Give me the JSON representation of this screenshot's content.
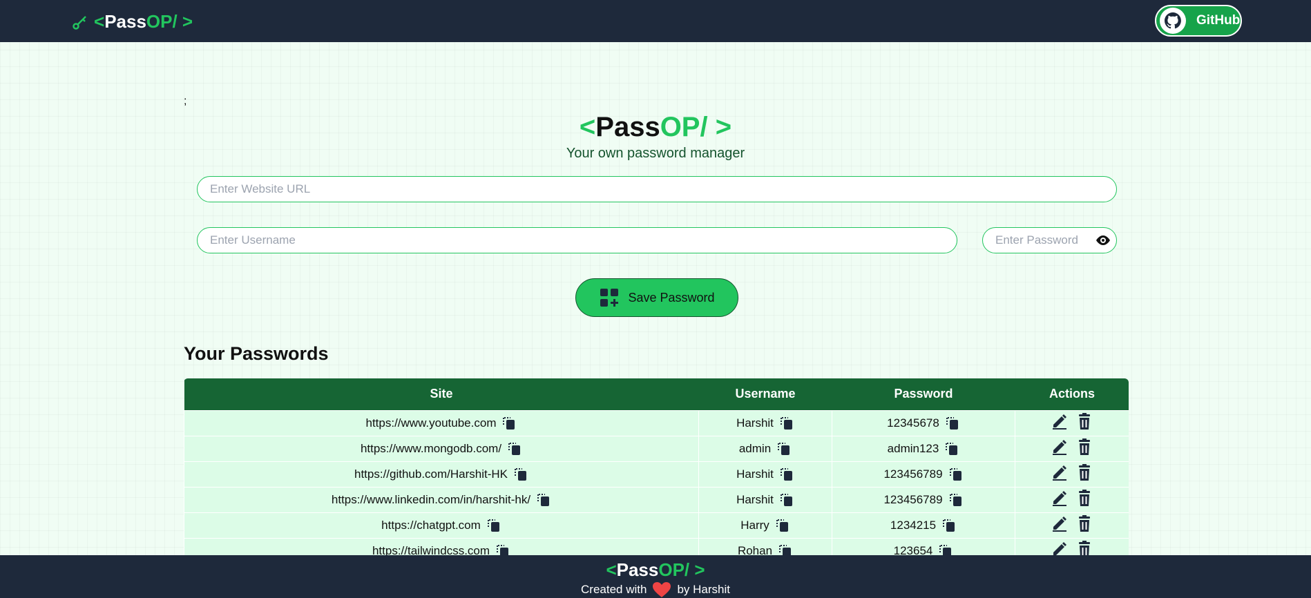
{
  "navbar": {
    "brand_open": "<",
    "brand_pass": "Pass",
    "brand_op": "OP/ >",
    "github_label": "GitHub"
  },
  "stray_text": ";",
  "hero": {
    "brand_open": "<",
    "brand_pass": "Pass",
    "brand_op": "OP/ >",
    "subtitle": "Your own password manager"
  },
  "form": {
    "url_placeholder": "Enter Website URL",
    "username_placeholder": "Enter Username",
    "password_placeholder": "Enter Password",
    "save_label": "Save Password"
  },
  "section": {
    "heading": "Your Passwords"
  },
  "table": {
    "headers": {
      "site": "Site",
      "username": "Username",
      "password": "Password",
      "actions": "Actions"
    },
    "rows": [
      {
        "site": "https://www.youtube.com",
        "username": "Harshit",
        "password": "12345678"
      },
      {
        "site": "https://www.mongodb.com/",
        "username": "admin",
        "password": "admin123"
      },
      {
        "site": "https://github.com/Harshit-HK",
        "username": "Harshit",
        "password": "123456789"
      },
      {
        "site": "https://www.linkedin.com/in/harshit-hk/",
        "username": "Harshit",
        "password": "123456789"
      },
      {
        "site": "https://chatgpt.com",
        "username": "Harry",
        "password": "1234215"
      },
      {
        "site": "https://tailwindcss.com",
        "username": "Rohan",
        "password": "123654"
      }
    ]
  },
  "footer": {
    "brand_open": "<",
    "brand_pass": "Pass",
    "brand_op": "OP/ >",
    "created_with": "Created with",
    "by": "by Harshit"
  },
  "colors": {
    "nav_bg": "#1e293b",
    "accent_green": "#22c55e",
    "table_header": "#166534",
    "row_bg": "#dcfce7",
    "page_bg": "#f0fdf4",
    "heart": "#ef4444"
  },
  "icons": [
    "key-icon",
    "github-icon",
    "eye-icon",
    "add-password-icon",
    "copy-icon",
    "edit-icon",
    "delete-icon",
    "heart-icon"
  ]
}
